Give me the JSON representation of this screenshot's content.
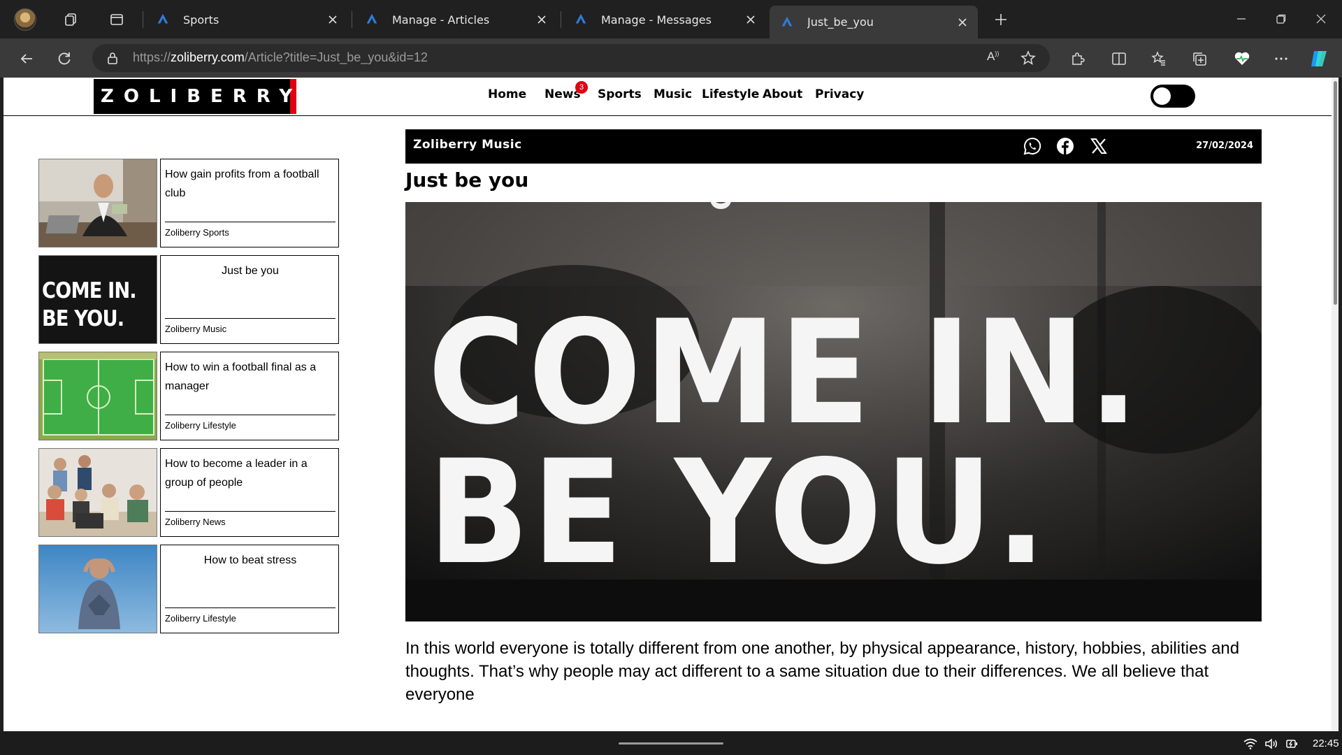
{
  "browser": {
    "tabs": [
      {
        "title": "Sports",
        "active": false
      },
      {
        "title": "Manage - Articles",
        "active": false
      },
      {
        "title": "Manage - Messages",
        "active": false
      },
      {
        "title": "Just_be_you",
        "active": true
      }
    ],
    "address": {
      "prefix": "https://",
      "domain": "zoliberry.com",
      "path": "/Article?title=Just_be_you&id=12"
    },
    "read_aloud_label": "A",
    "icons": [
      "profile-icon",
      "workspaces-icon",
      "tab-actions-icon",
      "back-icon",
      "refresh-icon",
      "lock-icon",
      "read-aloud-icon",
      "favorite-star-icon",
      "extensions-icon",
      "split-screen-icon",
      "favorites-icon",
      "collections-icon",
      "browser-essentials-icon",
      "more-icon",
      "copilot-icon"
    ]
  },
  "site": {
    "logo": "ZOLIBERRY",
    "nav": [
      {
        "label": "Home"
      },
      {
        "label": "News",
        "badge": "3"
      },
      {
        "label": "Sports"
      },
      {
        "label": "Music"
      },
      {
        "label": "Lifestyle"
      },
      {
        "label": "About"
      },
      {
        "label": "Privacy"
      }
    ],
    "theme_toggle": "off"
  },
  "sidebar": {
    "cards": [
      {
        "title": "How gain profits from a football club",
        "category": "Zoliberry Sports",
        "image": "businessman-with-money"
      },
      {
        "title": "Just be you",
        "category": "Zoliberry Music",
        "image": "come-in-be-you-sign",
        "thumb_line1": "COME IN.",
        "thumb_line2": "BE YOU."
      },
      {
        "title": "How to win a football final as a manager",
        "category": "Zoliberry Lifestyle",
        "image": "football-pitch-aerial"
      },
      {
        "title": "How to become a leader in a group of people",
        "category": "Zoliberry News",
        "image": "group-of-people"
      },
      {
        "title": "How to beat stress",
        "category": "Zoliberry Lifestyle",
        "image": "stressed-man"
      }
    ]
  },
  "article": {
    "source": "Zoliberry Music",
    "date": "27/02/2024",
    "share": [
      "whatsapp-icon",
      "facebook-icon",
      "x-icon"
    ],
    "title": "Just be you",
    "hero": {
      "line1": "COME IN.",
      "line2": "BE YOU.",
      "partial_text": "Co"
    },
    "body": "In this world everyone is totally different from one another, by physical appearance, history, hobbies, abilities and thoughts. That’s why people may act different to a same situation due to their differences. We all believe that everyone"
  },
  "taskbar": {
    "time": "22:45",
    "tray": [
      "wifi-icon",
      "volume-icon",
      "battery-icon"
    ]
  }
}
